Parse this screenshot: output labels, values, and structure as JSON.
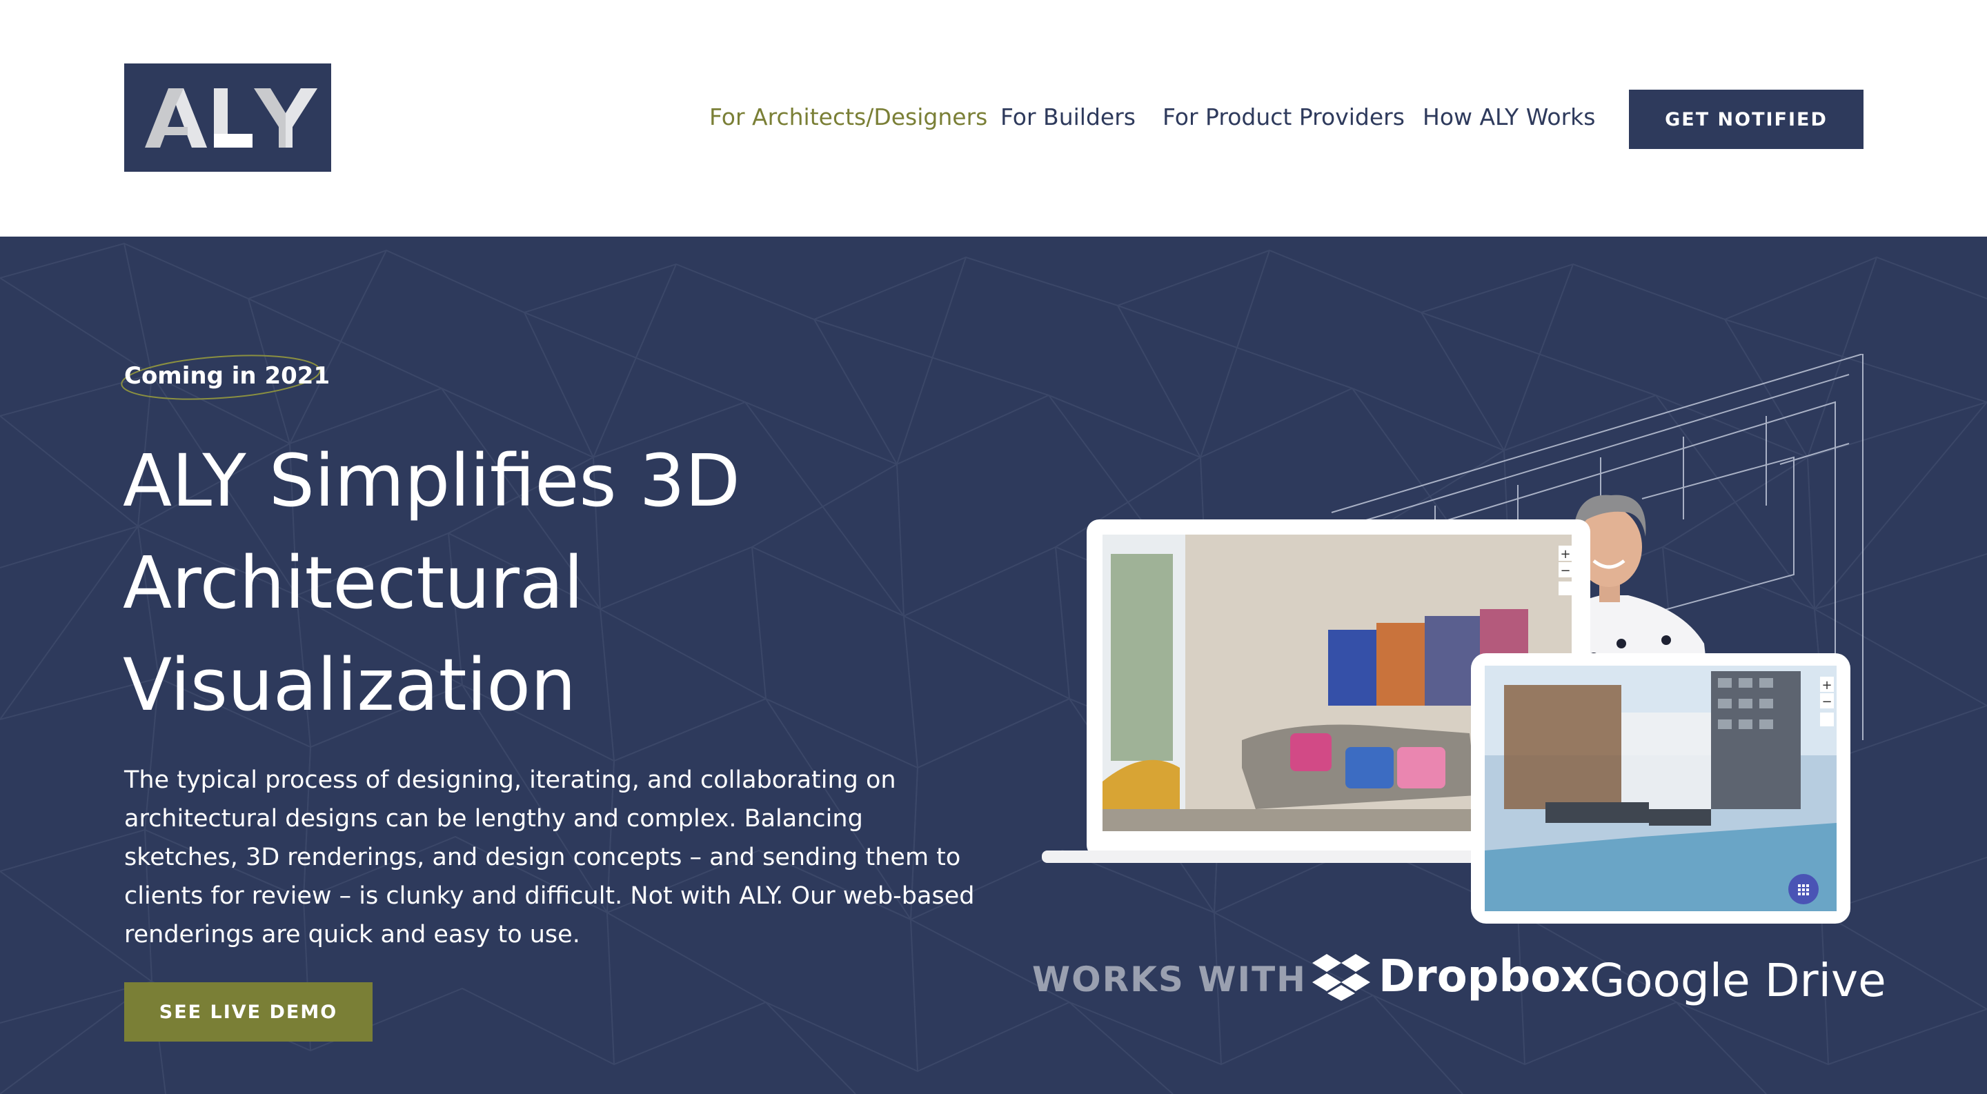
{
  "header": {
    "logo_text": "ALY",
    "nav": [
      {
        "label": "For Architects/Designers",
        "active": true
      },
      {
        "label": "For Builders",
        "active": false
      },
      {
        "label": "For Product Providers",
        "active": false
      },
      {
        "label": "How ALY Works",
        "active": false
      }
    ],
    "cta_label": "GET NOTIFIED"
  },
  "hero": {
    "eyebrow": "Coming in 2021",
    "title_lines": [
      "ALY Simplifies 3D",
      "Architectural",
      "Visualization"
    ],
    "description": "The typical process of designing, iterating, and collaborating on architectural designs can be lengthy and complex. Balancing sketches, 3D renderings, and design concepts – and sending them to clients for review – is clunky and difficult. Not with ALY. Our web-based renderings are quick and easy to use.",
    "demo_label": "SEE LIVE DEMO",
    "zoom_in": "+",
    "zoom_out": "−"
  },
  "works_with": {
    "label": "WORKS WITH",
    "partners": [
      "Dropbox",
      "Google Drive"
    ]
  },
  "colors": {
    "navy": "#2e3a5c",
    "olive": "#7a7f36",
    "white": "#ffffff"
  }
}
